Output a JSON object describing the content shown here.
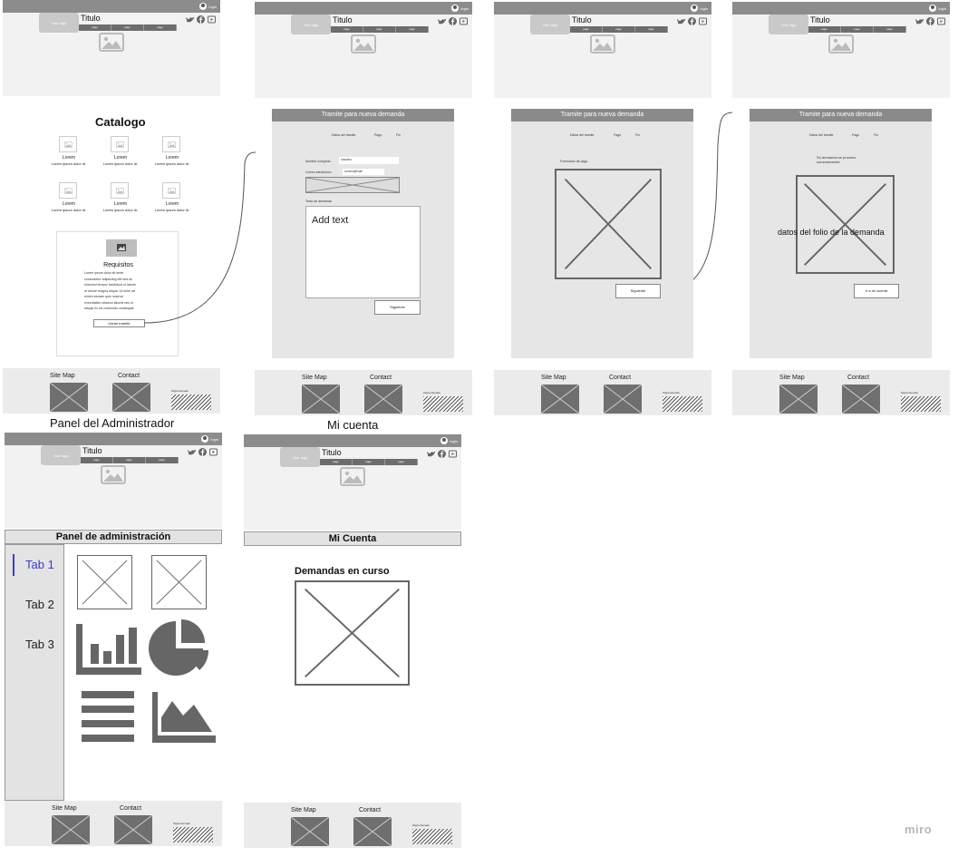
{
  "header": {
    "login": "login",
    "logo": "Your logo",
    "title": "Titulo",
    "nav": [
      "page",
      "page",
      "page"
    ]
  },
  "catalog": {
    "title": "Catalogo",
    "item_title": "Lorem",
    "item_text": "Lorem ipsum dolor dr.",
    "requirements_title": "Requisitos",
    "requirements": [
      "Lorem ipsum dolor sit amet",
      "consectetur adipiscing elit sed do",
      "eiusmod tempor incididunt ut labore",
      "et dolore magna aliqua. Ut enim ad",
      "minim veniam quis nostrud",
      "exercitation ullamco laboris nisi ut",
      "aliquip ex ea commodo consequat."
    ],
    "start_button": "Iniciar tramite"
  },
  "form": {
    "panel_title": "Tramite para nueva demanda",
    "steps": [
      "Datos del tramite",
      "Pago",
      "Fin"
    ],
    "name_label": "Nombre completo",
    "name_value": "Usuario",
    "email_label": "Correo electronico",
    "email_value": "correo@mail",
    "text_label": "Texto de demanda",
    "textarea": "Add text",
    "send_button": "Siguiente"
  },
  "payment": {
    "panel_title": "Tramite para nueva demanda",
    "form_label": "Formulario de pago",
    "next_button": "Siguiente"
  },
  "done": {
    "panel_title": "Tramite para nueva demanda",
    "msg": "Su demanda se proceso correctamente",
    "folio": "datos del folio de la demanda",
    "account_button": "Ir a mi cuenta"
  },
  "footer": {
    "sitemap": "Site Map",
    "contact": "Contact",
    "stamp": "Pagina disenada"
  },
  "admin": {
    "page_label": "Panel del Administrador",
    "bar_title": "Panel de administración",
    "tabs": [
      "Tab 1",
      "Tab 2",
      "Tab 3"
    ]
  },
  "account": {
    "page_label": "Mi cuenta",
    "bar_title": "Mi Cuenta",
    "demands_title": "Demandas en curso"
  },
  "watermark": "miro"
}
